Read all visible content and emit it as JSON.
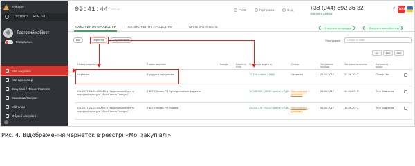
{
  "sidebar": {
    "logo_text": "e-tender",
    "prozorro": [
      "prozorro",
      "RIALTO"
    ],
    "profile_name": "Тестовий кабінет",
    "status": "Майданчик",
    "menu": [
      {
        "label": "Мої закупівлі",
        "active": true
      },
      {
        "label": "Мої пропозиції",
        "active": false
      },
      {
        "label": "Закупівлі / Плани Prozorro",
        "active": false
      },
      {
        "label": "Замовник/Скарги",
        "active": false
      },
      {
        "label": "Мій план",
        "active": false
      },
      {
        "label": "Обрані закупівлі",
        "active": false
      }
    ],
    "icons": [
      "triangle-logo",
      "user",
      "toggle",
      "menu-item",
      "bottom-round"
    ]
  },
  "header": {
    "clock": "09:41:44",
    "clock_suffix": "UTC+2",
    "links": [
      "РесD",
      "Підтримка",
      "Вхід"
    ],
    "phone": "+38 (044) 392 36 82",
    "phone_sub": "Замовити дзвінок",
    "social": [
      "f",
      "You"
    ]
  },
  "tabs": [
    {
      "label": "Конкурентні процедури",
      "active": true
    },
    {
      "label": "Неконкурентні процедури",
      "active": false
    },
    {
      "label": "Архів закупівель",
      "active": false
    }
  ],
  "actions": [
    "+ Створити процедуру",
    "+ Створити за шаблоном"
  ],
  "filters": {
    "buttons": [
      "Всі",
      "Чернетки",
      "Опубліковані"
    ],
    "search_label": "Фільтрувати",
    "search_placeholder": "Пошук по назві..."
  },
  "pager": [
    "30",
    "100",
    "200"
  ],
  "table": {
    "columns": [
      "Номер закупівлі",
      "Назва закупівлі",
      "Позиція",
      "Вартість лоту",
      "Очікувана вартість",
      "Статус",
      "Звітування оголош.",
      "Звітування пропоз.",
      "Контактна особа"
    ],
    "rows": [
      {
        "num": "Чернетка",
        "name": "Продукти харчування",
        "pos": "",
        "lot": "",
        "value": "12 345 гривня з ПДВ",
        "status": "Чернетка",
        "d1": "21-06-2017",
        "d2": "24-06-2017",
        "contact": "Олена Ген.",
        "highlight": true
      },
      {
        "num": "UA-2017-06-01-000060-a Національний центр народної культури 'Музей Івана Гончара'",
        "name": "ПБО*Обнова-PR Культурологічне видання",
        "pos": "",
        "lot": "",
        "value": "10 000 000 000.00 гривня з ПДВ",
        "status": "Кваліфікація учасника",
        "d1": "06-06-2017",
        "d2": "14-06-2017",
        "contact": "Тест Замовник",
        "highlight": false
      },
      {
        "num": "UA-2017-06-02-000081-b Національний центр народної культури 'Музей Івана Гончара'",
        "name": "ПБО*Обнова-PR Зошити",
        "pos": "",
        "lot": "",
        "value": "25 000 074 503.00 гривня з ПДВ",
        "status": "Кваліфікація учасника",
        "d1": "06-06-2017",
        "d2": "16-06-2017",
        "contact": "Тест Замовник",
        "highlight": false
      }
    ]
  },
  "caption": "Рис. 4. Відображення чернеток в реєстрі «Мої закупівлі»",
  "colors": {
    "sidebar": "#2f3337",
    "active": "#d2362c",
    "accent": "#3aa65f",
    "annotation": "#e0261f"
  }
}
